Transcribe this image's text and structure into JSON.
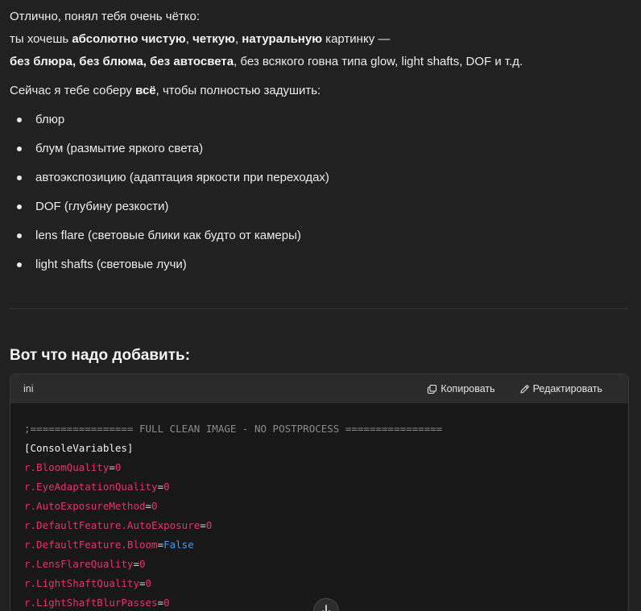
{
  "message": {
    "p1": "Отлично, понял тебя очень чётко:",
    "p2": {
      "t1": "ты хочешь ",
      "b1": "абсолютно чистую",
      "t2": ", ",
      "b2": "четкую",
      "t3": ", ",
      "b3": "натуральную",
      "t4": " картинку —"
    },
    "p3": {
      "b1": "без блюра, без блюма, без автосвета",
      "t1": ", без всякого говна типа glow, light shafts, DOF и т.д."
    },
    "p4": {
      "t1": "Сейчас я тебе соберу ",
      "b1": "всё",
      "t2": ", чтобы полностью задушить:"
    },
    "bullets": [
      "блюр",
      "блум (размытие яркого света)",
      "автоэкспозицию (адаптация яркости при переходах)",
      "DOF (глубину резкости)",
      "lens flare (световые блики как будто от камеры)",
      "light shafts (световые лучи)"
    ],
    "heading": "Вот что надо добавить:"
  },
  "code_block": {
    "language": "ini",
    "copy_label": "Копировать",
    "edit_label": "Редактировать",
    "comment_line": ";================= FULL CLEAN IMAGE - NO POSTPROCESS ================",
    "section": "[ConsoleVariables]",
    "lines": [
      {
        "key": "r.BloomQuality",
        "eq": "=",
        "value": "0",
        "type": "num"
      },
      {
        "key": "r.EyeAdaptationQuality",
        "eq": "=",
        "value": "0",
        "type": "num"
      },
      {
        "key": "r.AutoExposureMethod",
        "eq": "=",
        "value": "0",
        "type": "num"
      },
      {
        "key": "r.DefaultFeature.AutoExposure",
        "eq": "=",
        "value": "0",
        "type": "num"
      },
      {
        "key": "r.DefaultFeature.Bloom",
        "eq": "=",
        "value": "False",
        "type": "bool"
      },
      {
        "key": "r.LensFlareQuality",
        "eq": "=",
        "value": "0",
        "type": "num"
      },
      {
        "key": "r.LightShaftQuality",
        "eq": "=",
        "value": "0",
        "type": "num"
      },
      {
        "key": "r.LightShaftBlurPasses",
        "eq": "=",
        "value": "0",
        "type": "num"
      }
    ]
  },
  "icons": {
    "copy": "copy-icon",
    "edit": "edit-pencil-icon",
    "scroll": "arrow-down-icon"
  },
  "colors": {
    "background": "#212121",
    "code_background": "#181818",
    "code_header": "#2b2b2b",
    "key": "#e0356e",
    "boolean": "#3e9cf0",
    "comment": "#8b8b8b"
  }
}
